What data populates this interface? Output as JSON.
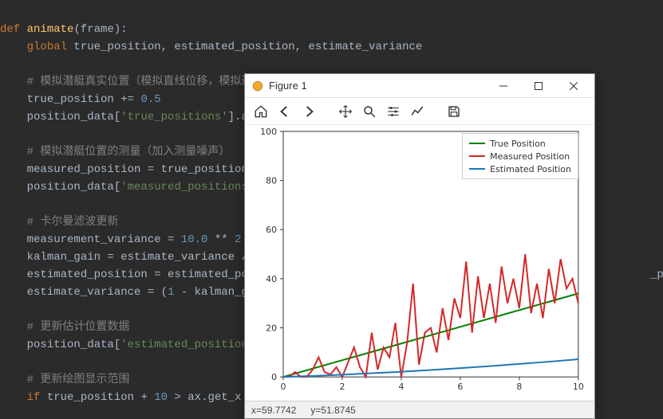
{
  "code": {
    "l01_def": "def",
    "l01_fn": "animate",
    "l01_param": "frame",
    "l02_kw": "global",
    "l02_rest": " true_position, estimated_position, estimate_variance",
    "l04_cmt": "# 模拟潜艇真实位置（模拟直线位移，模拟过程噪声）",
    "l05_a": "true_position += ",
    "l05_n": "0.5",
    "l06_a": "position_data[",
    "l06_s": "'true_positions'",
    "l06_b": "].a",
    "l08_cmt": "# 模拟潜艇位置的测量（加入测量噪声）",
    "l09": "measured_position = true_position",
    "l10_a": "position_data[",
    "l10_s": "'measured_positions",
    "l12_cmt": "# 卡尔曼滤波更新",
    "l13_a": "measurement_variance = ",
    "l13_n1": "10.0",
    "l13_b": " ** ",
    "l13_n2": "2",
    "l14": "kalman_gain = estimate_variance /",
    "l15_a": "estimated_position = estimated_po",
    "l15_tail": "_position)",
    "l16_a": "estimate_variance = (",
    "l16_n": "1",
    "l16_b": " - kalman_g",
    "l18_cmt": "# 更新估计位置数据",
    "l19_a": "position_data[",
    "l19_s": "'estimated_position",
    "l21_cmt": "# 更新绘图显示范围",
    "l22_a": "if",
    "l22_b": " true_position + ",
    "l22_n": "10",
    "l22_c": " > ax.get_x"
  },
  "figure": {
    "title": "Figure 1",
    "status_x_label": "x=",
    "status_x": "59.7742",
    "status_y_label": "y=",
    "status_y": "51.8745",
    "legend": {
      "true": "True Position",
      "measured": "Measured Position",
      "estimated": "Estimated Position"
    }
  },
  "chart_data": {
    "type": "line",
    "xlim": [
      0,
      10
    ],
    "ylim": [
      0,
      100
    ],
    "xticks": [
      0,
      2,
      4,
      6,
      8,
      10
    ],
    "yticks": [
      0,
      20,
      40,
      60,
      80,
      100
    ],
    "series": [
      {
        "name": "True Position",
        "color": "#008000",
        "x": [
          0,
          1,
          2,
          3,
          4,
          5,
          6,
          7,
          8,
          9,
          10
        ],
        "values": [
          0,
          3.4,
          6.8,
          10.2,
          13.6,
          17,
          20.4,
          23.8,
          27.2,
          30.6,
          34
        ]
      },
      {
        "name": "Measured Position",
        "color": "#d62728",
        "x": [
          0,
          0.2,
          0.4,
          0.6,
          0.8,
          1,
          1.2,
          1.4,
          1.6,
          1.8,
          2,
          2.2,
          2.4,
          2.6,
          2.8,
          3,
          3.2,
          3.4,
          3.6,
          3.8,
          4,
          4.2,
          4.4,
          4.6,
          4.8,
          5,
          5.2,
          5.4,
          5.6,
          5.8,
          6,
          6.2,
          6.4,
          6.6,
          6.8,
          7,
          7.2,
          7.4,
          7.6,
          7.8,
          8,
          8.2,
          8.4,
          8.6,
          8.8,
          9,
          9.2,
          9.4,
          9.6,
          9.8,
          10
        ],
        "values": [
          0,
          0,
          2,
          0,
          0,
          3,
          8,
          2,
          1,
          4,
          0,
          6,
          12,
          4,
          0,
          18,
          3,
          12,
          8,
          22,
          0,
          14,
          38,
          5,
          18,
          20,
          10,
          28,
          15,
          32,
          24,
          47,
          18,
          41,
          24,
          38,
          22,
          45,
          30,
          40,
          28,
          50,
          26,
          38,
          24,
          44,
          30,
          48,
          36,
          40,
          30
        ]
      },
      {
        "name": "Estimated Position",
        "color": "#1f77b4",
        "x": [
          0,
          1,
          2,
          3,
          4,
          5,
          6,
          7,
          8,
          9,
          10
        ],
        "values": [
          0,
          0.4,
          0.9,
          1.5,
          2.1,
          2.8,
          3.6,
          4.4,
          5.3,
          6.2,
          7.2
        ]
      }
    ]
  }
}
